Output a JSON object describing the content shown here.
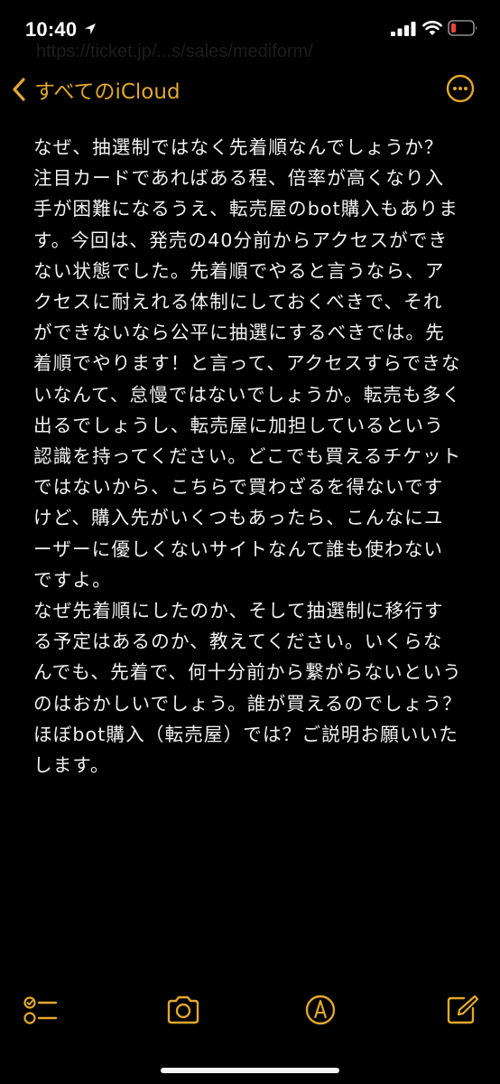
{
  "status_bar": {
    "time": "10:40"
  },
  "background_url": "https://ticket.jp/...s/sales/mediform/",
  "nav": {
    "back_label": "すべてのiCloud"
  },
  "note": {
    "paragraphs": [
      "なぜ、抽選制ではなく先着順なんでしょうか？注目カードであればある程、倍率が高くなり入手が困難になるうえ、転売屋のbot購入もあります。今回は、発売の40分前からアクセスができない状態でした。先着順でやると言うなら、アクセスに耐えれる体制にしておくべきで、それができないなら公平に抽選にするべきでは。先着順でやります！と言って、アクセスすらできないなんて、怠慢ではないでしょうか。転売も多く出るでしょうし、転売屋に加担しているという認識を持ってください。どこでも買えるチケットではないから、こちらで買わざるを得ないですけど、購入先がいくつもあったら、こんなにユーザーに優しくないサイトなんて誰も使わないですよ。",
      "なぜ先着順にしたのか、そして抽選制に移行する予定はあるのか、教えてください。いくらなんでも、先着で、何十分前から繋がらないというのはおかしいでしょう。誰が買えるのでしょう？ほぼbot購入（転売屋）では？ご説明お願いいたします。"
    ]
  },
  "colors": {
    "accent": "#e2a82c",
    "background": "#000000",
    "text": "#f2f2f2",
    "battery_low": "#e5443a"
  },
  "icons": {
    "status": [
      "location-arrow-icon",
      "signal-icon",
      "wifi-icon",
      "battery-icon"
    ],
    "nav": [
      "chevron-left-icon",
      "more-icon"
    ],
    "toolbar": [
      "checklist-icon",
      "camera-icon",
      "markup-pen-icon",
      "compose-icon"
    ]
  }
}
